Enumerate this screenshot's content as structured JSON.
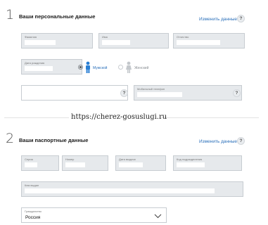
{
  "personal": {
    "step": "1",
    "title": "Ваши персональные данные",
    "edit_label": "Изменить данные",
    "help": "?",
    "lastname_label": "Фамилия",
    "firstname_label": "Имя",
    "middlename_label": "Отчество",
    "birthdate_label": "Дата рождения",
    "gender_male": "Мужской",
    "gender_female": "Женский",
    "gender_selected": "male",
    "mobile_label": "Мобильный телефон"
  },
  "watermark": "https://cherez-gosuslugi.ru",
  "passport": {
    "step": "2",
    "title": "Ваши паспортные данные",
    "edit_label": "Изменить данные",
    "help": "?",
    "series_label": "Серия",
    "number_label": "Номер",
    "issue_date_label": "Дата выдачи",
    "dept_code_label": "Код подразделения",
    "issued_by_label": "Кем выдан",
    "citizenship_label": "Гражданство",
    "citizenship_value": "Россия"
  },
  "colors": {
    "link": "#2a6fba",
    "field_bg": "#e6e9ec",
    "male_icon": "#2a7fd4",
    "female_icon": "#c4c8cc"
  }
}
